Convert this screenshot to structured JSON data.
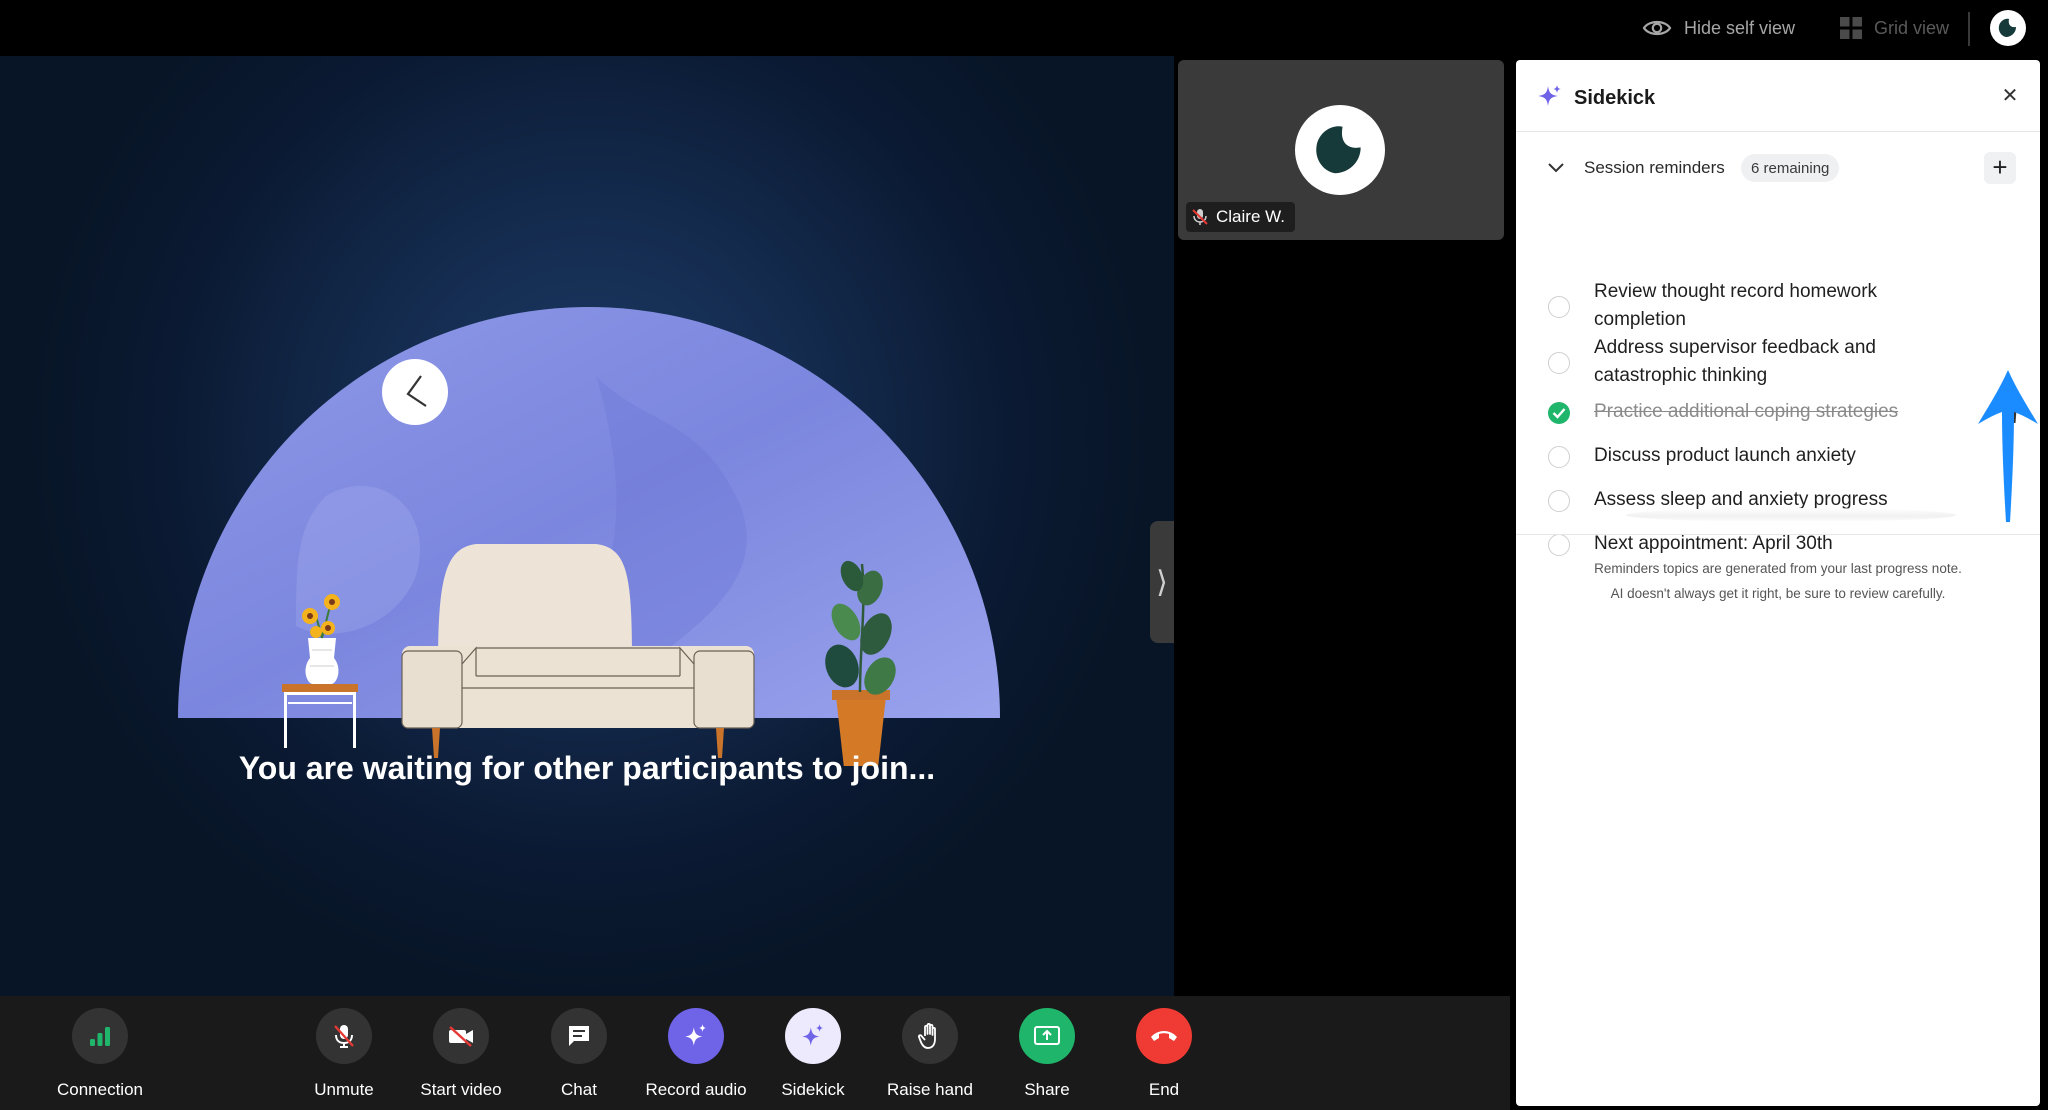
{
  "topbar": {
    "hide_self_view": "Hide self view",
    "grid_view": "Grid view"
  },
  "stage": {
    "waiting_text": "You are waiting for other participants to join..."
  },
  "participant": {
    "name": "Claire W.",
    "muted": true
  },
  "sidekick": {
    "title": "Sidekick",
    "section_title": "Session reminders",
    "remaining_badge": "6 remaining",
    "items": [
      {
        "text": "Review thought record homework completion",
        "done": false
      },
      {
        "text": "Address supervisor feedback and catastrophic thinking",
        "done": false
      },
      {
        "text": "Practice additional coping strategies",
        "done": true
      },
      {
        "text": "Discuss product launch anxiety",
        "done": false
      },
      {
        "text": "Assess sleep and anxiety progress",
        "done": false
      },
      {
        "text": "Next appointment: April 30th",
        "done": false
      }
    ],
    "footnote_line1": "Reminders topics are generated from your last progress note.",
    "footnote_line2": "AI doesn't always get it right, be sure to review carefully."
  },
  "controls": {
    "connection": "Connection",
    "unmute": "Unmute",
    "start_video": "Start video",
    "chat": "Chat",
    "record_audio": "Record audio",
    "sidekick": "Sidekick",
    "raise_hand": "Raise hand",
    "share": "Share",
    "end": "End"
  },
  "colors": {
    "accent_purple": "#6f63e8",
    "share_green": "#1fb56a",
    "end_red": "#ef3b33",
    "annotation_blue": "#1a8cff",
    "brand_dark": "#163a3a"
  }
}
